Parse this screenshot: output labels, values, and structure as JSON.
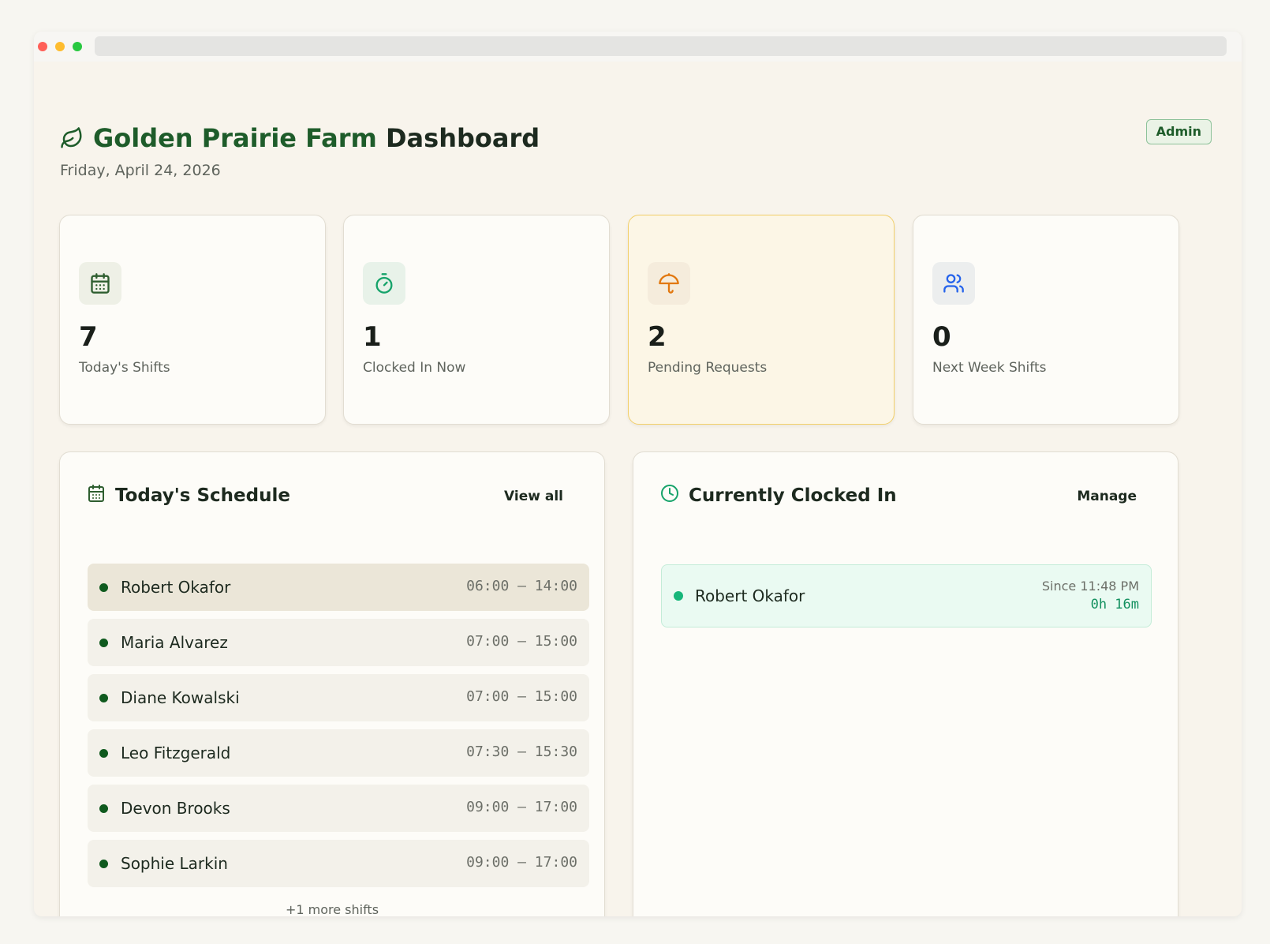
{
  "header": {
    "farm_name": "Golden Prairie Farm",
    "title_suffix": "Dashboard",
    "date": "Friday, April 24, 2026",
    "role_badge": "Admin"
  },
  "stats": [
    {
      "value": "7",
      "label": "Today's Shifts",
      "icon": "calendar-icon",
      "color": "#2e5e2f"
    },
    {
      "value": "1",
      "label": "Clocked In Now",
      "icon": "stopwatch-icon",
      "color": "#16a36a"
    },
    {
      "value": "2",
      "label": "Pending Requests",
      "icon": "umbrella-icon",
      "color": "#e2780f"
    },
    {
      "value": "0",
      "label": "Next Week Shifts",
      "icon": "users-icon",
      "color": "#2563eb"
    }
  ],
  "schedule": {
    "title": "Today's Schedule",
    "action": "View all",
    "rows": [
      {
        "name": "Robert Okafor",
        "time": "06:00 – 14:00"
      },
      {
        "name": "Maria Alvarez",
        "time": "07:00 – 15:00"
      },
      {
        "name": "Diane Kowalski",
        "time": "07:00 – 15:00"
      },
      {
        "name": "Leo Fitzgerald",
        "time": "07:30 – 15:30"
      },
      {
        "name": "Devon Brooks",
        "time": "09:00 – 17:00"
      },
      {
        "name": "Sophie Larkin",
        "time": "09:00 – 17:00"
      }
    ],
    "more": "+1 more shifts"
  },
  "clocked_in": {
    "title": "Currently Clocked In",
    "action": "Manage",
    "rows": [
      {
        "name": "Robert Okafor",
        "since": "Since 11:48 PM",
        "duration": "0h 16m"
      }
    ]
  },
  "colors": {
    "brand": "#1e5c2a",
    "highlight_border": "#f2cf6a",
    "clocked_green": "#17b67a"
  }
}
